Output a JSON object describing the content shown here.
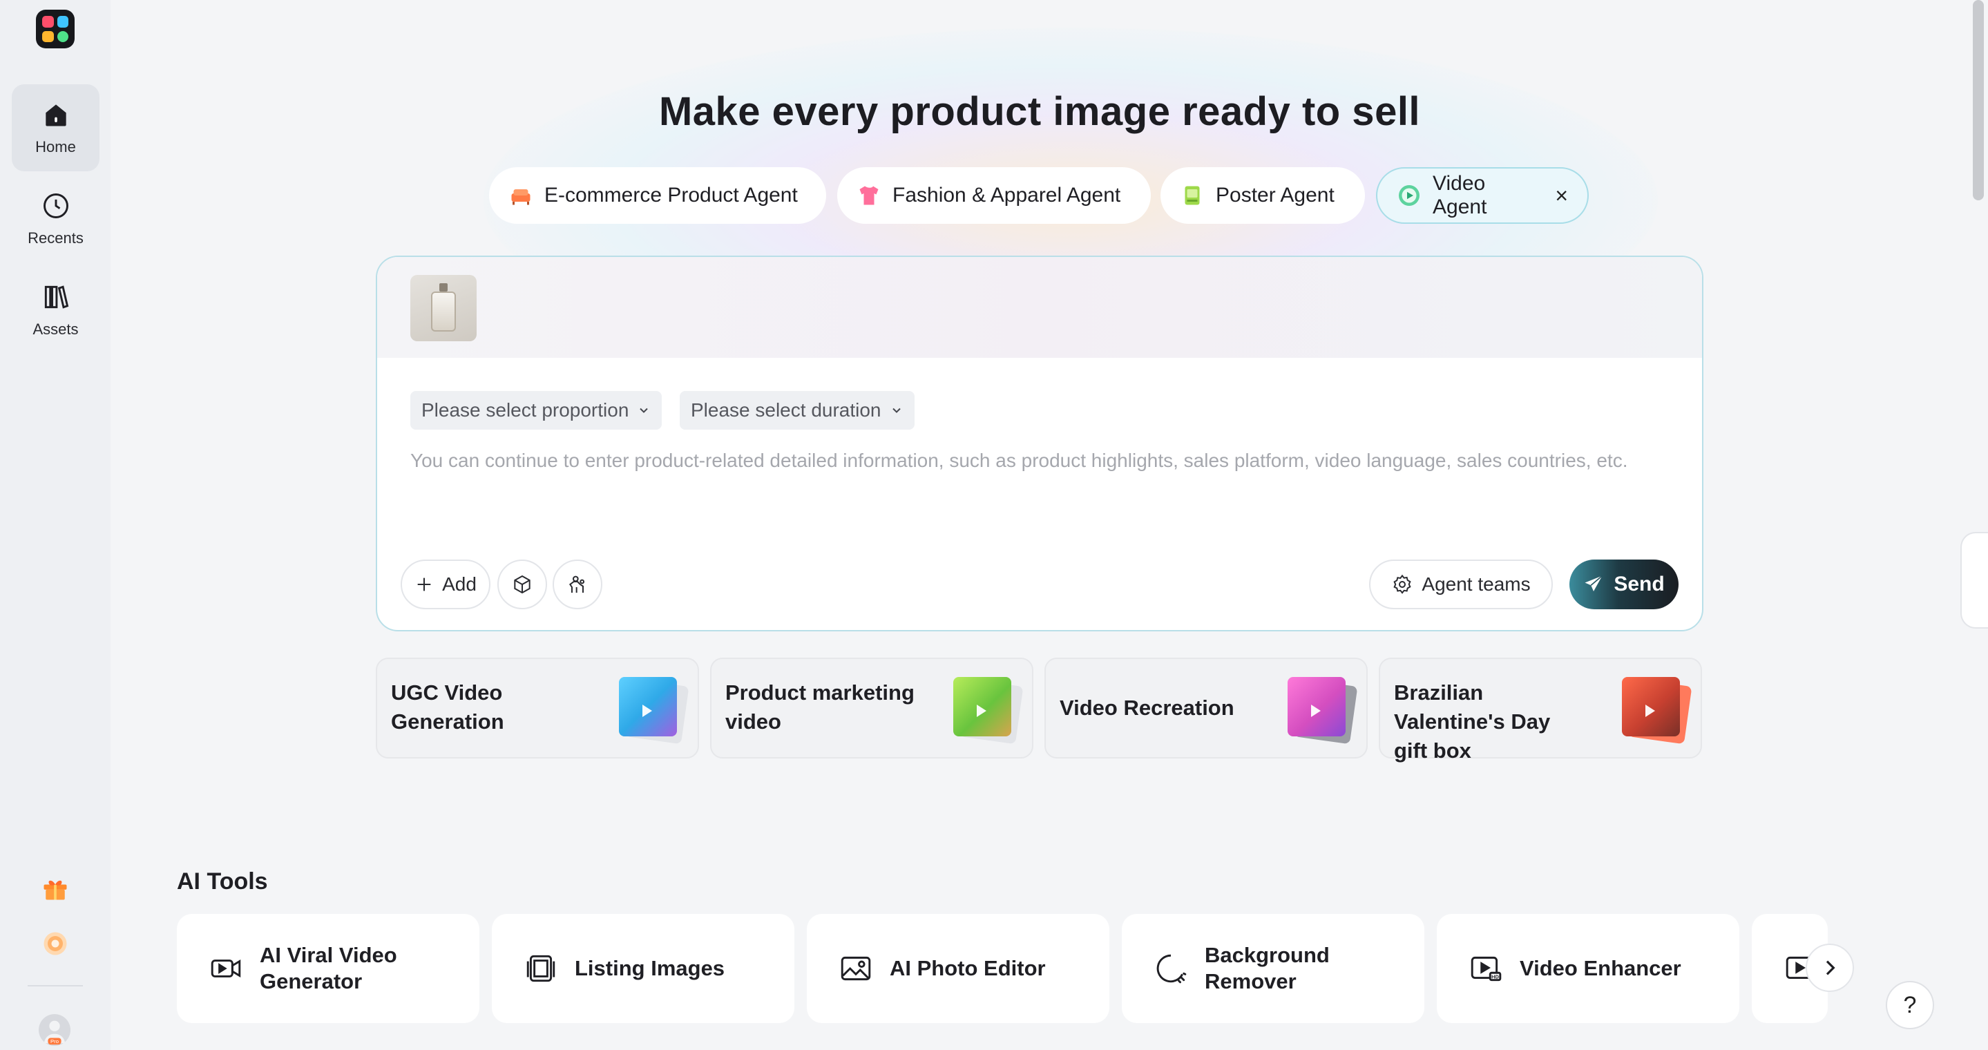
{
  "sidebar": {
    "items": [
      {
        "label": "Home",
        "icon": "home-icon",
        "active": true
      },
      {
        "label": "Recents",
        "icon": "clock-icon"
      },
      {
        "label": "Assets",
        "icon": "library-icon"
      }
    ],
    "bottom_icons": [
      "gift-icon",
      "coin-icon"
    ],
    "avatar_badge": "Pro"
  },
  "main": {
    "headline": "Make every product image ready to sell",
    "agents": [
      {
        "label": "E-commerce Product Agent",
        "icon": "sofa-icon"
      },
      {
        "label": "Fashion & Apparel Agent",
        "icon": "shirt-icon"
      },
      {
        "label": "Poster Agent",
        "icon": "poster-icon"
      },
      {
        "label": "Video Agent",
        "icon": "video-agent-icon",
        "selected": true,
        "close": "×"
      }
    ],
    "composer": {
      "proportion_select": "Please select proportion",
      "duration_select": "Please select duration",
      "placeholder": "You can continue to enter product-related detailed information, such as product highlights, sales platform, video language, sales countries, etc.",
      "add_label": "Add",
      "agent_teams_label": "Agent teams",
      "send_label": "Send"
    },
    "templates": [
      {
        "title": "UGC Video Generation"
      },
      {
        "title": "Product marketing video"
      },
      {
        "title": "Video Recreation"
      },
      {
        "title": "Brazilian Valentine's Day gift box"
      }
    ],
    "ai_tools": {
      "title": "AI Tools",
      "items": [
        {
          "label": "AI Viral Video Generator",
          "icon": "video-camera-icon"
        },
        {
          "label": "Listing Images",
          "icon": "listing-images-icon"
        },
        {
          "label": "AI Photo Editor",
          "icon": "photo-editor-icon"
        },
        {
          "label": "Background Remover",
          "icon": "background-remover-icon"
        },
        {
          "label": "Video Enhancer",
          "icon": "hd-video-icon"
        }
      ]
    },
    "help_label": "?"
  },
  "colors": {
    "accent_border": "#b9dfe8",
    "send_gradient_start": "#3b8c9c",
    "send_gradient_end": "#1a1d22",
    "page_bg": "#f4f5f7"
  }
}
